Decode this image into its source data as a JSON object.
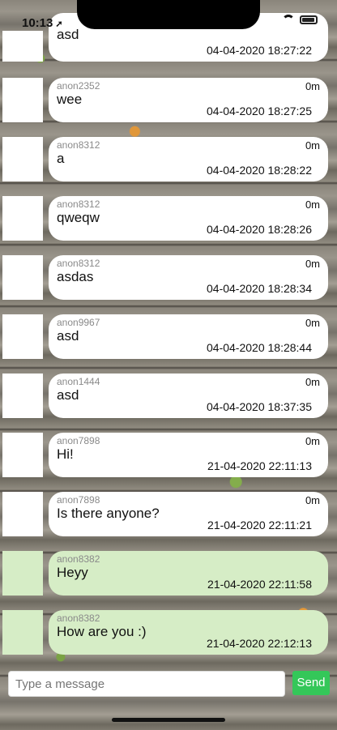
{
  "status_bar": {
    "time": "10:13",
    "location_arrow": "location-arrow-icon",
    "wifi": "wifi-icon",
    "battery": "battery-icon"
  },
  "messages": [
    {
      "sender": "",
      "age": "",
      "text": "asd",
      "timestamp": "04-04-2020 18:27:22",
      "mine": false
    },
    {
      "sender": "anon2352",
      "age": "0m",
      "text": "wee",
      "timestamp": "04-04-2020 18:27:25",
      "mine": false
    },
    {
      "sender": "anon8312",
      "age": "0m",
      "text": "a",
      "timestamp": "04-04-2020 18:28:22",
      "mine": false
    },
    {
      "sender": "anon8312",
      "age": "0m",
      "text": "qweqw",
      "timestamp": "04-04-2020 18:28:26",
      "mine": false
    },
    {
      "sender": "anon8312",
      "age": "0m",
      "text": "asdas",
      "timestamp": "04-04-2020 18:28:34",
      "mine": false
    },
    {
      "sender": "anon9967",
      "age": "0m",
      "text": "asd",
      "timestamp": "04-04-2020 18:28:44",
      "mine": false
    },
    {
      "sender": "anon1444",
      "age": "0m",
      "text": "asd",
      "timestamp": "04-04-2020 18:37:35",
      "mine": false
    },
    {
      "sender": "anon7898",
      "age": "0m",
      "text": "Hi!",
      "timestamp": "21-04-2020 22:11:13",
      "mine": false
    },
    {
      "sender": "anon7898",
      "age": "0m",
      "text": "Is there anyone?",
      "timestamp": "21-04-2020 22:11:21",
      "mine": false
    },
    {
      "sender": "anon8382",
      "age": "",
      "text": "Heyy",
      "timestamp": "21-04-2020 22:11:58",
      "mine": true
    },
    {
      "sender": "anon8382",
      "age": "",
      "text": "How are you :)",
      "timestamp": "21-04-2020 22:12:13",
      "mine": true
    }
  ],
  "composer": {
    "placeholder": "Type a message",
    "send_label": "Send"
  },
  "colors": {
    "own_bubble": "#d6edc6",
    "other_bubble": "#ffffff",
    "send_button": "#34c759"
  }
}
